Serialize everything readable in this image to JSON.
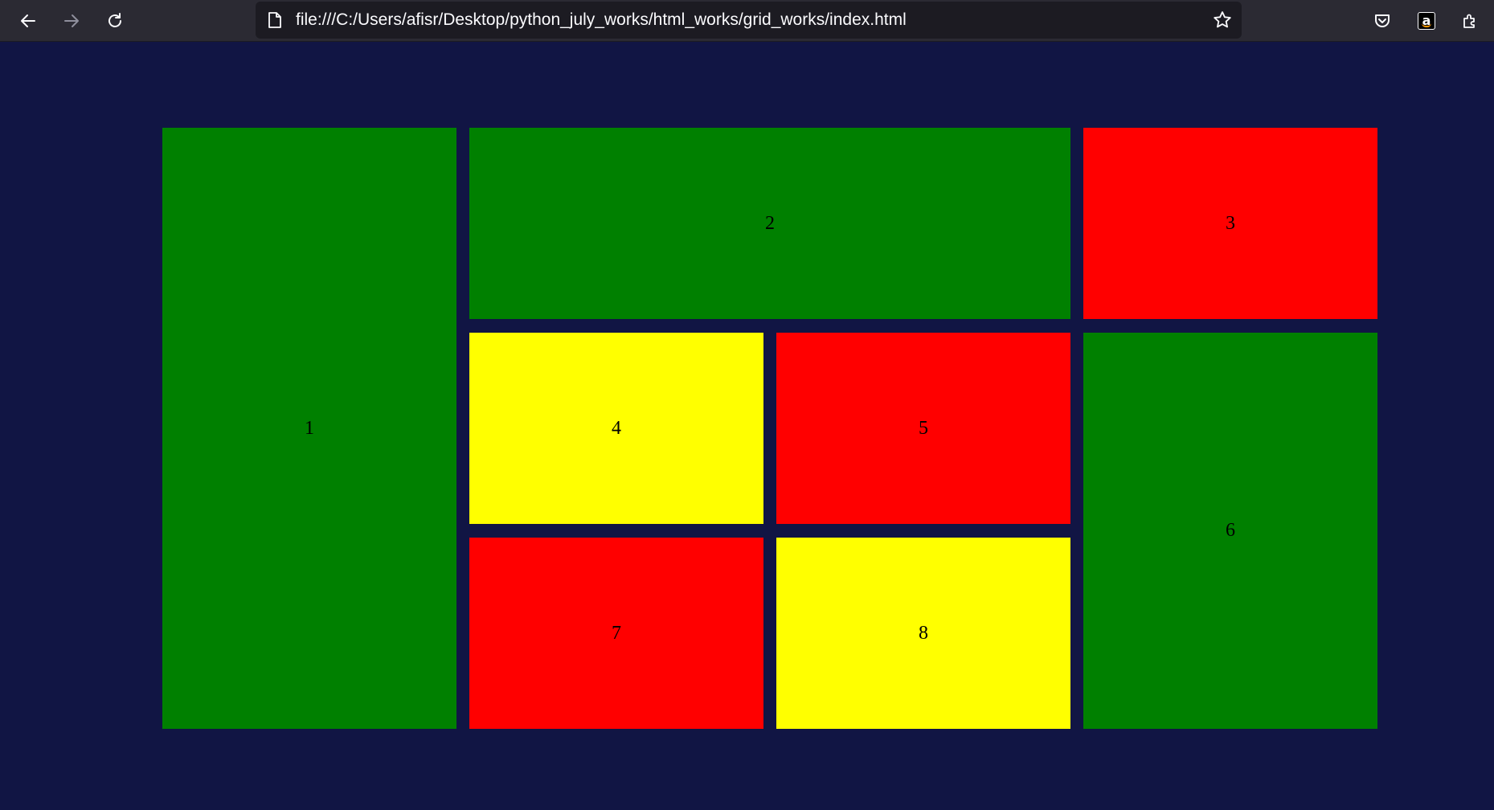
{
  "browser": {
    "url": "file:///C:/Users/afisr/Desktop/python_july_works/html_works/grid_works/index.html",
    "toolbar_icons": [
      "back-arrow-icon",
      "forward-arrow-icon",
      "reload-icon",
      "page-icon",
      "bookmark-star-icon",
      "pocket-icon",
      "amazon-icon",
      "extensions-icon"
    ],
    "amazon_label": "a"
  },
  "page": {
    "background": "#111544",
    "grid_items": [
      {
        "label": "1",
        "color": "#008000"
      },
      {
        "label": "2",
        "color": "#008000"
      },
      {
        "label": "3",
        "color": "#ff0000"
      },
      {
        "label": "4",
        "color": "#ffff00"
      },
      {
        "label": "5",
        "color": "#ff0000"
      },
      {
        "label": "6",
        "color": "#008000"
      },
      {
        "label": "7",
        "color": "#ff0000"
      },
      {
        "label": "8",
        "color": "#ffff00"
      }
    ]
  }
}
